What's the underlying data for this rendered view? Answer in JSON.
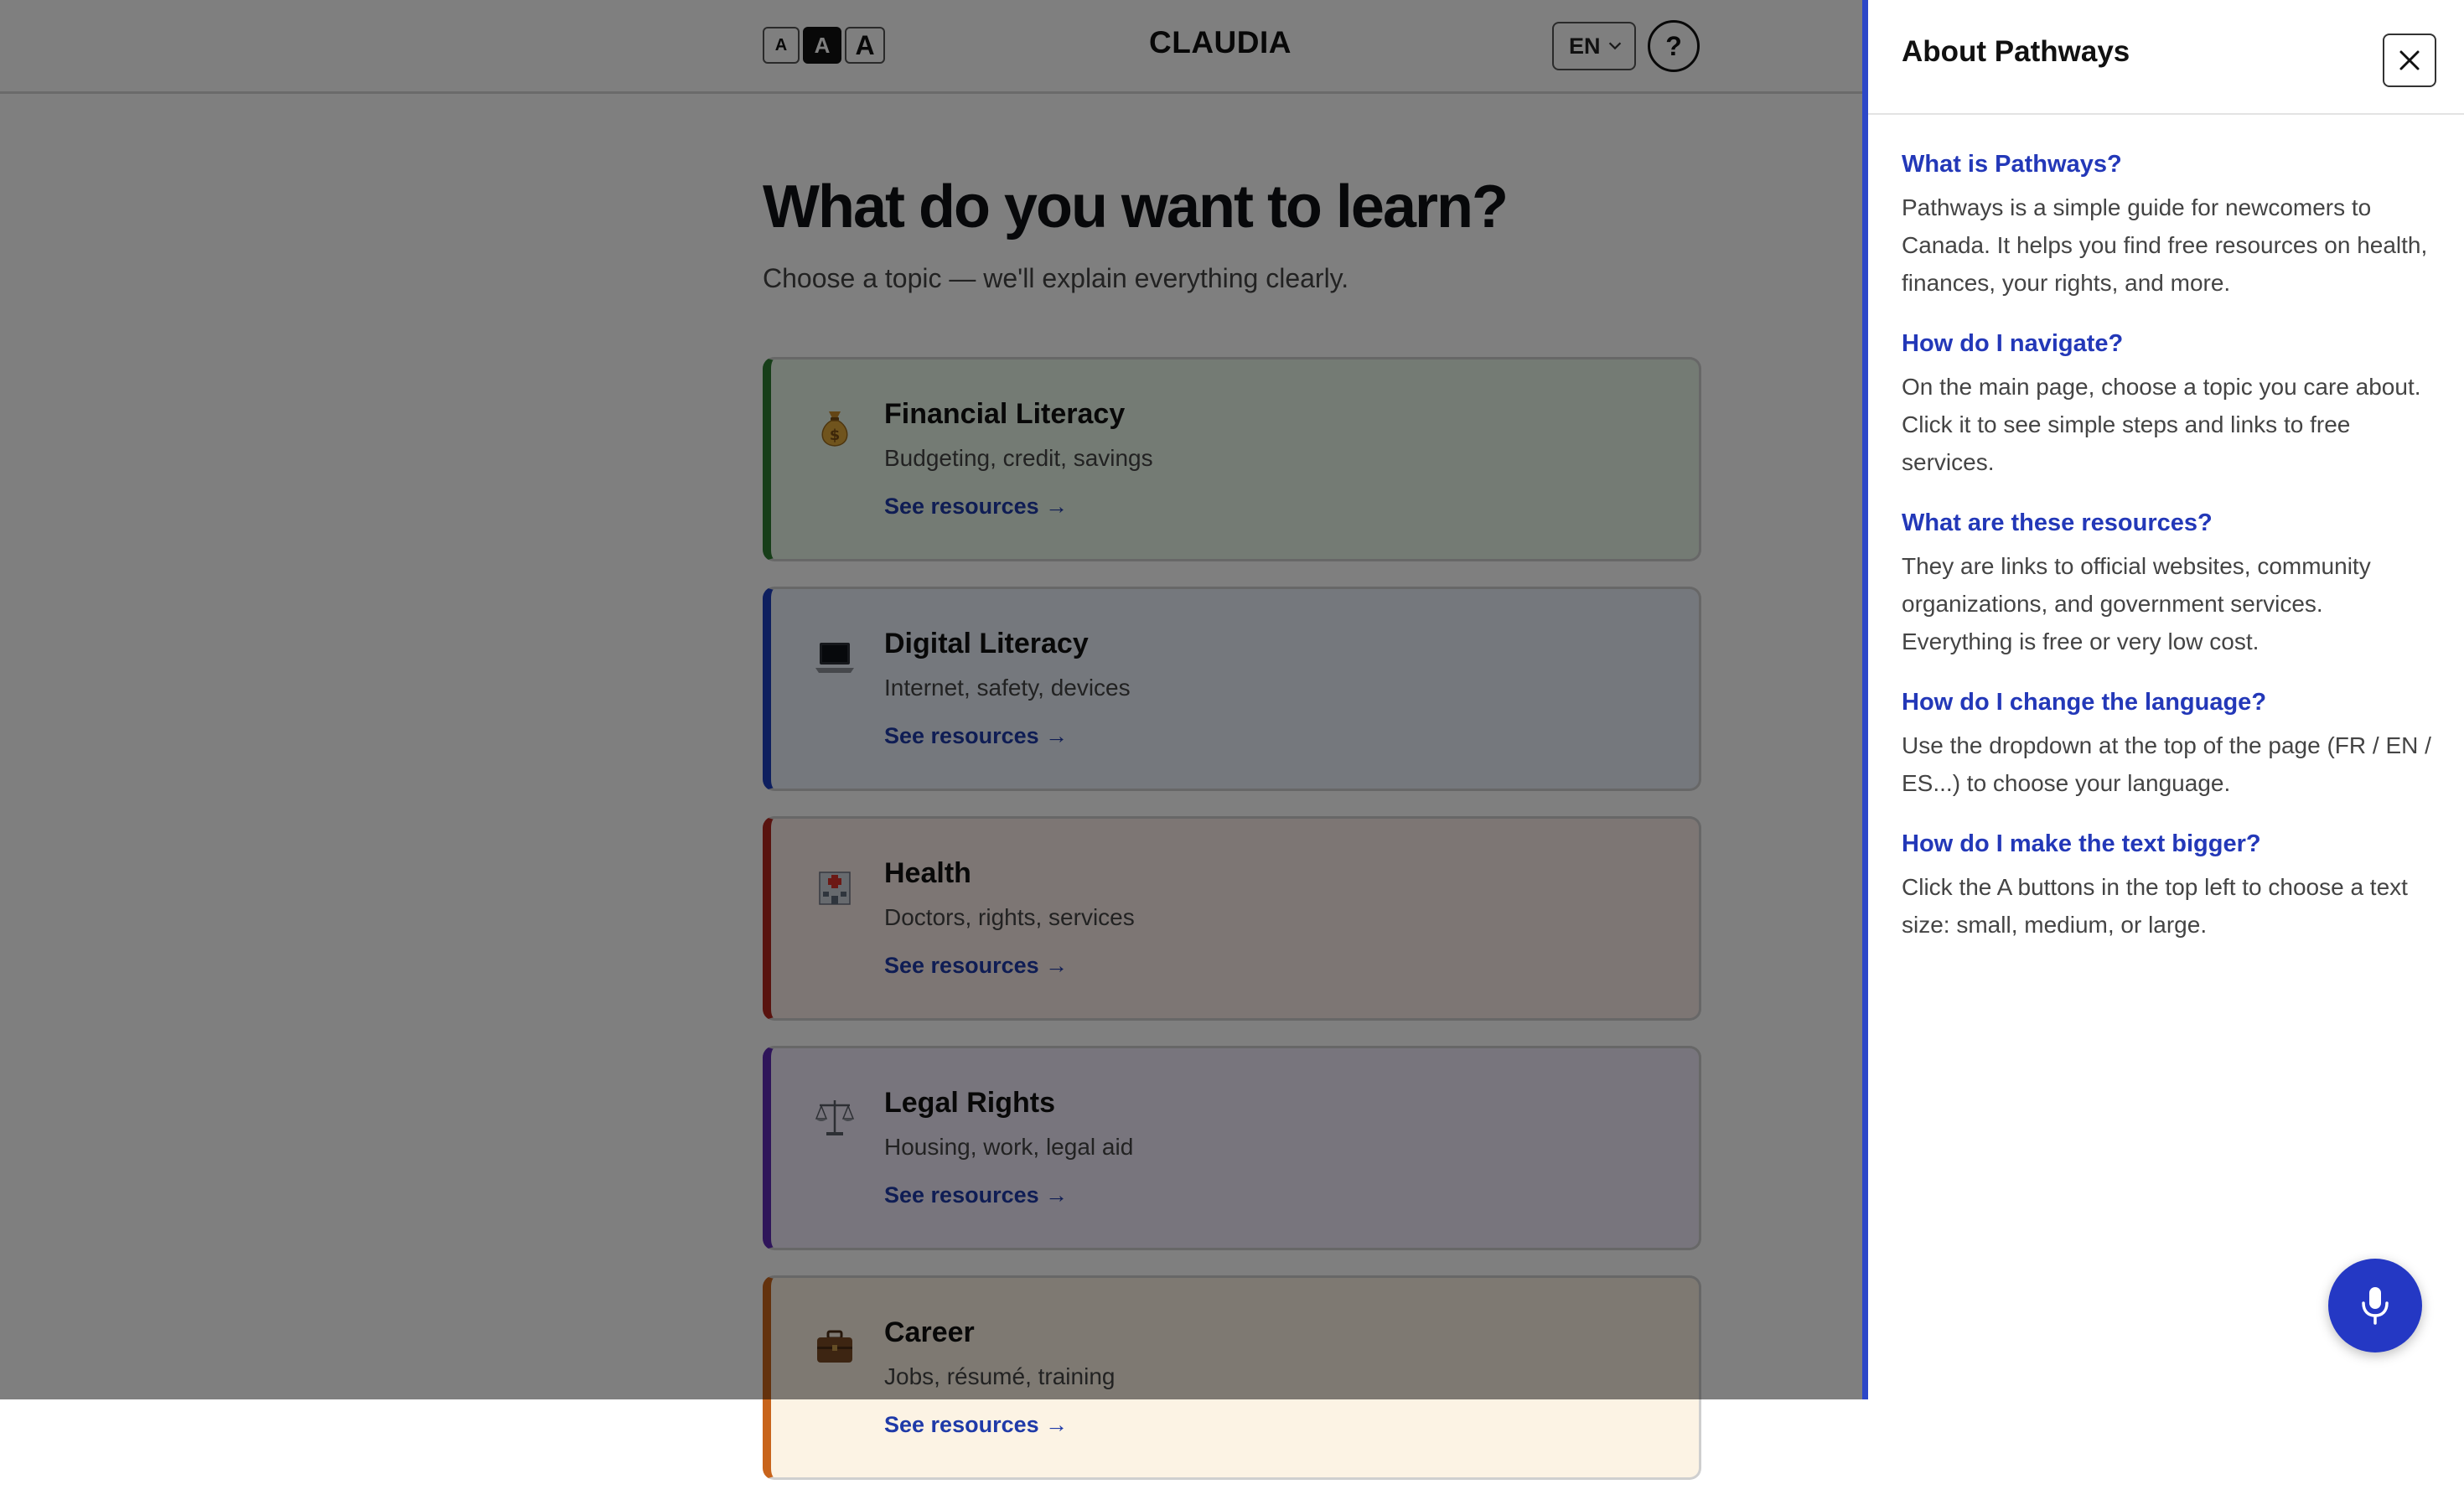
{
  "header": {
    "text_size_buttons": [
      {
        "label": "A",
        "size": "small"
      },
      {
        "label": "A",
        "size": "medium",
        "selected": true
      },
      {
        "label": "A",
        "size": "large"
      }
    ],
    "brand": "CLAUDIA",
    "language": "EN",
    "help_label": "?"
  },
  "hero": {
    "title": "What do you want to learn?",
    "subtitle": "Choose a topic — we'll explain everything clearly."
  },
  "topics": [
    {
      "title": "Financial Literacy",
      "subtitle": "Budgeting, credit, savings",
      "link": "See resources →",
      "icon": "money-bag-icon",
      "accent": "#2e7d32",
      "bg": "#e9f6e9"
    },
    {
      "title": "Digital Literacy",
      "subtitle": "Internet, safety, devices",
      "link": "See resources →",
      "icon": "laptop-icon",
      "accent": "#1d3fbf",
      "bg": "#eaf0fb"
    },
    {
      "title": "Health",
      "subtitle": "Doctors, rights, services",
      "link": "See resources →",
      "icon": "hospital-icon",
      "accent": "#b3261e",
      "bg": "#fbece9"
    },
    {
      "title": "Legal Rights",
      "subtitle": "Housing, work, legal aid",
      "link": "See resources →",
      "icon": "scales-icon",
      "accent": "#5e2bb5",
      "bg": "#f0ebfa"
    },
    {
      "title": "Career",
      "subtitle": "Jobs, résumé, training",
      "link": "See resources →",
      "icon": "briefcase-icon",
      "accent": "#c8641b",
      "bg": "#fcf3e4"
    }
  ],
  "panel": {
    "title": "About Pathways",
    "faq": [
      {
        "q": "What is Pathways?",
        "a": "Pathways is a simple guide for newcomers to Canada. It helps you find free resources on health, finances, your rights, and more."
      },
      {
        "q": "How do I navigate?",
        "a": "On the main page, choose a topic you care about. Click it to see simple steps and links to free services."
      },
      {
        "q": "What are these resources?",
        "a": "They are links to official websites, community organizations, and government services. Everything is free or very low cost."
      },
      {
        "q": "How do I change the language?",
        "a": "Use the dropdown at the top of the page (FR / EN / ES...) to choose your language."
      },
      {
        "q": "How do I make the text bigger?",
        "a": "Click the A buttons in the top left to choose a text size: small, medium, or large."
      }
    ]
  },
  "colors": {
    "panel_accent": "#2d48c8",
    "link": "#1f3aa8",
    "mic_button": "#2438c4"
  }
}
